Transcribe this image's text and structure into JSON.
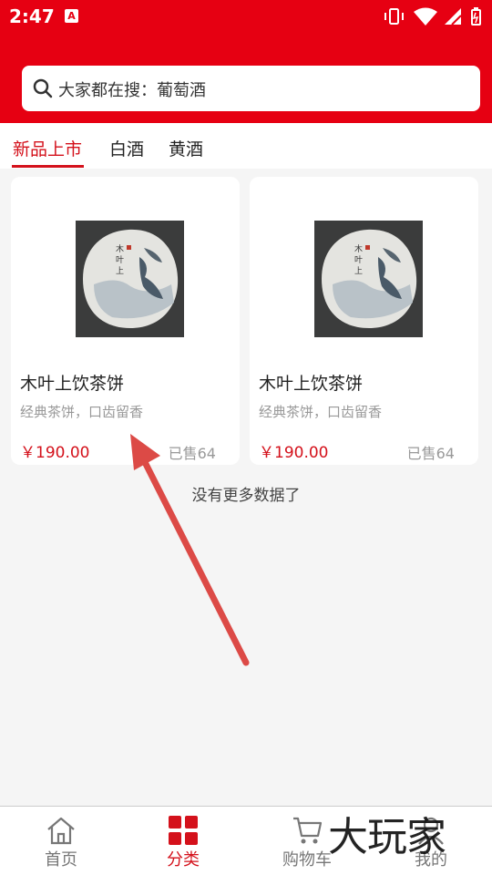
{
  "status_bar": {
    "time": "2:47",
    "notification_badge": "A"
  },
  "search": {
    "label": "大家都在搜：葡萄酒",
    "icon": "search-icon"
  },
  "tabs": [
    {
      "label": "新品上市",
      "active": true
    },
    {
      "label": "白酒",
      "active": false
    },
    {
      "label": "黄酒",
      "active": false
    }
  ],
  "products": [
    {
      "name": "木叶上饮茶饼",
      "desc": "经典茶饼，口齿留香",
      "price": "￥190.00",
      "sold": "已售64"
    },
    {
      "name": "木叶上饮茶饼",
      "desc": "经典茶饼，口齿留香",
      "price": "￥190.00",
      "sold": "已售64"
    }
  ],
  "no_more": "没有更多数据了",
  "tabbar": [
    {
      "label": "首页",
      "icon": "home-icon",
      "active": false
    },
    {
      "label": "分类",
      "icon": "grid-icon",
      "active": true
    },
    {
      "label": "购物车",
      "icon": "cart-icon",
      "active": false
    },
    {
      "label": "我的",
      "icon": "user-icon",
      "active": false
    }
  ],
  "watermark": "大玩家",
  "colors": {
    "brand_red": "#e60012",
    "accent_red": "#d4111b",
    "background": "#f5f5f5"
  }
}
